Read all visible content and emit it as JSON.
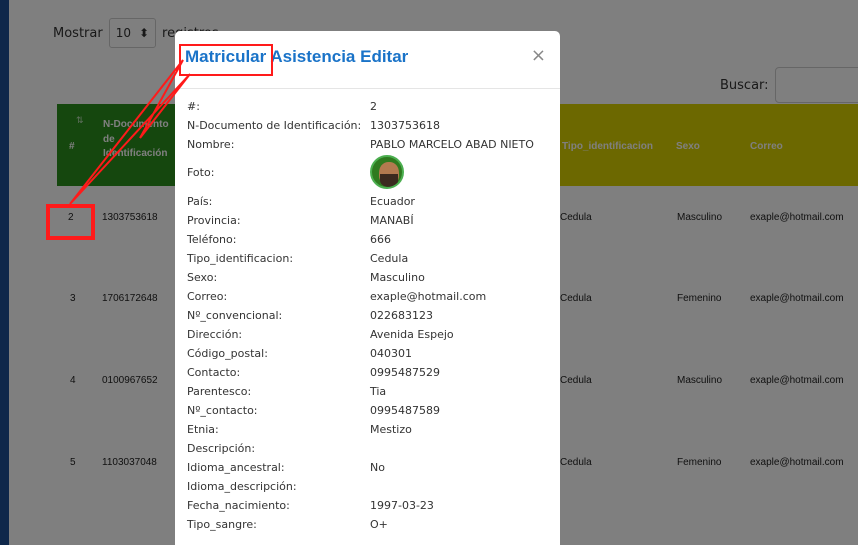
{
  "page": {
    "show_label": "Mostrar",
    "show_value": "10",
    "records_label": "registros",
    "search_label": "Buscar:"
  },
  "table": {
    "headers": [
      "#",
      "N-Documento de Identificación",
      "Tipo_identificacion",
      "Sexo",
      "Correo"
    ],
    "rows": [
      {
        "num": "2",
        "doc": "1303753618",
        "tipo": "Cedula",
        "sexo": "Masculino",
        "correo": "exaple@hotmail.com"
      },
      {
        "num": "3",
        "doc": "1706172648",
        "tipo": "Cedula",
        "sexo": "Femenino",
        "correo": "exaple@hotmail.com"
      },
      {
        "num": "4",
        "doc": "0100967652",
        "tipo": "Cedula",
        "sexo": "Masculino",
        "correo": "exaple@hotmail.com"
      },
      {
        "num": "5",
        "doc": "1103037048",
        "tipo": "Cedula",
        "sexo": "Femenino",
        "correo": "exaple@hotmail.com"
      }
    ]
  },
  "modal": {
    "title": "Matricular Asistencia Editar",
    "close": "×",
    "fields": [
      {
        "label": "#:",
        "value": "2"
      },
      {
        "label": "N-Documento de Identificación:",
        "value": "1303753618"
      },
      {
        "label": "Nombre:",
        "value": "PABLO MARCELO ABAD NIETO"
      },
      {
        "label": "Foto:",
        "value": ""
      },
      {
        "label": "País:",
        "value": "Ecuador"
      },
      {
        "label": "Provincia:",
        "value": "MANABÍ"
      },
      {
        "label": "Teléfono:",
        "value": "666"
      },
      {
        "label": "Tipo_identificacion:",
        "value": "Cedula"
      },
      {
        "label": "Sexo:",
        "value": "Masculino"
      },
      {
        "label": "Correo:",
        "value": "exaple@hotmail.com"
      },
      {
        "label": "Nº_convencional:",
        "value": "022683123"
      },
      {
        "label": "Dirección:",
        "value": "Avenida Espejo"
      },
      {
        "label": "Código_postal:",
        "value": "040301"
      },
      {
        "label": "Contacto:",
        "value": "0995487529"
      },
      {
        "label": "Parentesco:",
        "value": "Tia"
      },
      {
        "label": "Nº_contacto:",
        "value": "0995487589"
      },
      {
        "label": "Etnia:",
        "value": "Mestizo"
      },
      {
        "label": "Descripción:",
        "value": ""
      },
      {
        "label": "Idioma_ancestral:",
        "value": "No"
      },
      {
        "label": "Idioma_descripción:",
        "value": ""
      },
      {
        "label": "Fecha_nacimiento:",
        "value": "1997-03-23"
      },
      {
        "label": "Tipo_sangre:",
        "value": "O+"
      }
    ]
  },
  "colors": {
    "accent": "#1a73c8",
    "header_green": "#2a8f1c",
    "header_yellow": "#d8d100",
    "annotation_red": "#ff1a1a"
  }
}
